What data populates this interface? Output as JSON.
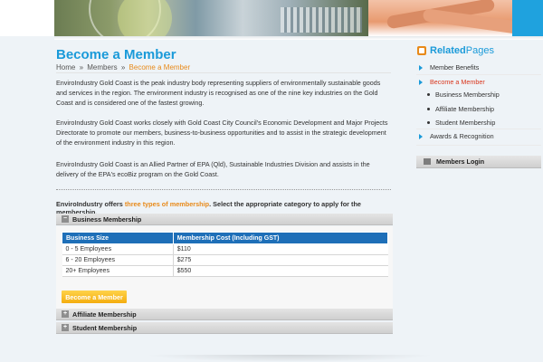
{
  "page": {
    "title": "Become a Member",
    "breadcrumb": [
      "Home",
      "Members",
      "Become a Member"
    ],
    "breadcrumb_separator": "»",
    "paragraphs": [
      "EnviroIndustry Gold Coast is the peak industry body representing suppliers of environmentally sustainable goods and services in the region.  The environment industry is recognised as one of the nine key industries on the Gold Coast and is considered one of the fastest growing.",
      "EnviroIndustry Gold Coast works closely with Gold Coast City Council's Economic Development and Major Projects Directorate to promote our members, business-to-business opportunities and to assist in the strategic development of the environment industry in this region.",
      "EnviroIndustry Gold Coast is an Allied Partner of EPA (Qld), Sustainable Industries Division and assists in the delivery of the EPA's ecoBiz program on the Gold Coast."
    ],
    "offer": {
      "prefix": "EnviroIndustry offers ",
      "highlight": "three types of membership",
      "suffix": ". Select the appropriate category to apply for the membership."
    }
  },
  "accordions": [
    {
      "label": "Business Membership",
      "expanded": true,
      "toggle": "−"
    },
    {
      "label": "Affiliate Membership",
      "expanded": false,
      "toggle": "+"
    },
    {
      "label": "Student Membership",
      "expanded": false,
      "toggle": "+"
    }
  ],
  "membership_table": {
    "headers": [
      "Business Size",
      "Membership Cost (Including GST)"
    ],
    "rows": [
      [
        "0 - 5 Employees",
        "$110"
      ],
      [
        "6 - 20 Employees",
        "$275"
      ],
      [
        "20+ Employees",
        "$550"
      ]
    ]
  },
  "cta_label": "Become a Member",
  "sidebar": {
    "title_a": "Related",
    "title_b": " Pages",
    "items": [
      {
        "label": "Member Benefits",
        "type": "arrow",
        "active": false
      },
      {
        "label": "Become a Member",
        "type": "arrow",
        "active": true
      },
      {
        "label": "Business Membership",
        "type": "bullet",
        "active": false
      },
      {
        "label": "Affiliate Membership",
        "type": "bullet",
        "active": false
      },
      {
        "label": "Student Membership",
        "type": "bullet",
        "active": false
      },
      {
        "label": "Awards & Recognition",
        "type": "arrow",
        "active": false
      }
    ],
    "login_label": "Members Login"
  },
  "colors": {
    "accent_blue": "#1a9ad9",
    "accent_orange": "#e88a1a",
    "active_red": "#d9371e",
    "table_header": "#1e6fb8",
    "cta_yellow": "#f4ad0f"
  }
}
